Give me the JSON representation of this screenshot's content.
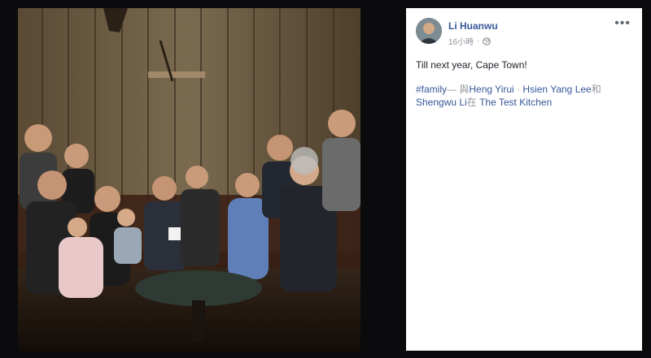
{
  "post": {
    "author": "Li Huanwu",
    "timestamp": "16小時",
    "privacy_icon": "globe-icon",
    "more_label": "•••",
    "text": "Till next year, Cape Town!",
    "hashtag": "#family",
    "with_prefix": "— 與",
    "tagged_1": "Heng Yirui",
    "separator": "·",
    "tagged_2": "Hsien Yang Lee",
    "and_word": "和",
    "tagged_3": "Shengwu Li",
    "at_word": "在",
    "location": "The Test Kitchen"
  },
  "colors": {
    "link": "#385898",
    "meta": "#90949c",
    "backdrop": "#0b0b0d"
  }
}
